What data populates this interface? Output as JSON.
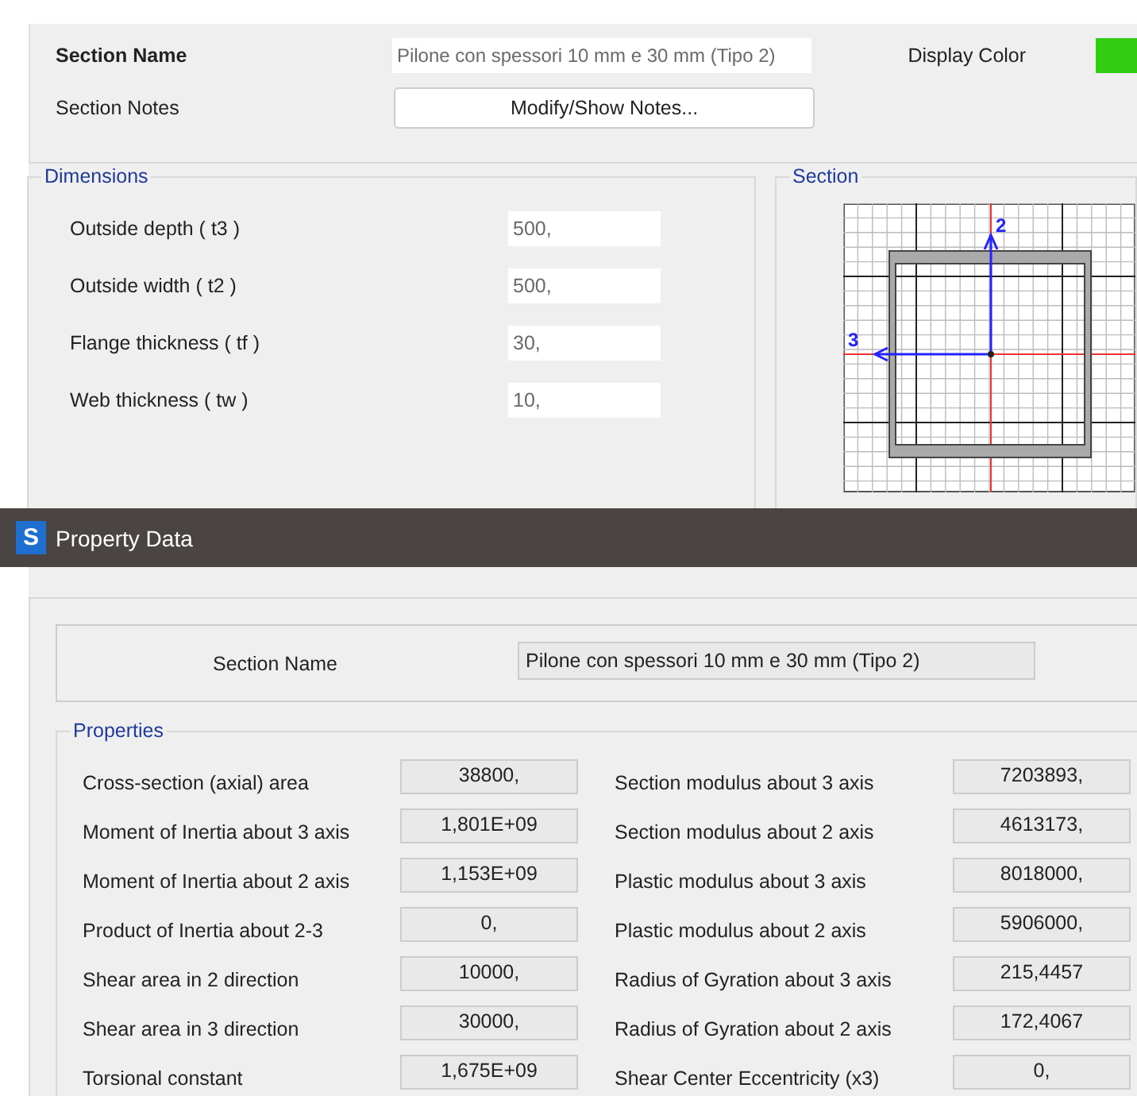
{
  "section_name": {
    "label": "Section Name",
    "value": "Pilone con spessori 10 mm e 30 mm (Tipo 2)"
  },
  "display_color": {
    "label": "Display Color",
    "color": "#33cc11"
  },
  "section_notes": {
    "label": "Section Notes",
    "button": "Modify/Show Notes..."
  },
  "dimensions": {
    "title": "Dimensions",
    "rows": [
      {
        "label": "Outside depth  ( t3 )",
        "value": "500,"
      },
      {
        "label": "Outside width  ( t2 )",
        "value": "500,"
      },
      {
        "label": "Flange thickness  ( tf )",
        "value": "30,"
      },
      {
        "label": "Web thickness  ( tw )",
        "value": "10,"
      }
    ]
  },
  "section_preview": {
    "title": "Section",
    "axis_vertical": "2",
    "axis_horizontal": "3"
  },
  "dialog": {
    "icon": "S",
    "title": "Property Data"
  },
  "property_section_name": {
    "label": "Section Name",
    "value": "Pilone con spessori 10 mm e 30 mm (Tipo 2)"
  },
  "properties": {
    "title": "Properties",
    "rows": [
      {
        "label": "Cross-section (axial) area",
        "value": "38800,",
        "label_2": "Section modulus about 3 axis",
        "value_2": "7203893,"
      },
      {
        "label": "Moment of Inertia about 3 axis",
        "value": "1,801E+09",
        "label_2": "Section modulus about 2 axis",
        "value_2": "4613173,"
      },
      {
        "label": "Moment of Inertia about 2 axis",
        "value": "1,153E+09",
        "label_2": "Plastic modulus about 3 axis",
        "value_2": "8018000,"
      },
      {
        "label": "Product of Inertia about 2-3",
        "value": "0,",
        "label_2": "Plastic modulus about 2 axis",
        "value_2": "5906000,"
      },
      {
        "label": "Shear area in 2 direction",
        "value": "10000,",
        "label_2": "Radius of Gyration about 3 axis",
        "value_2": "215,4457"
      },
      {
        "label": "Shear area in 3 direction",
        "value": "30000,",
        "label_2": "Radius of Gyration about 2 axis",
        "value_2": "172,4067"
      },
      {
        "label": "Torsional constant",
        "value": "1,675E+09",
        "label_2": "Shear Center Eccentricity (x3)",
        "value_2": "0,"
      }
    ]
  }
}
